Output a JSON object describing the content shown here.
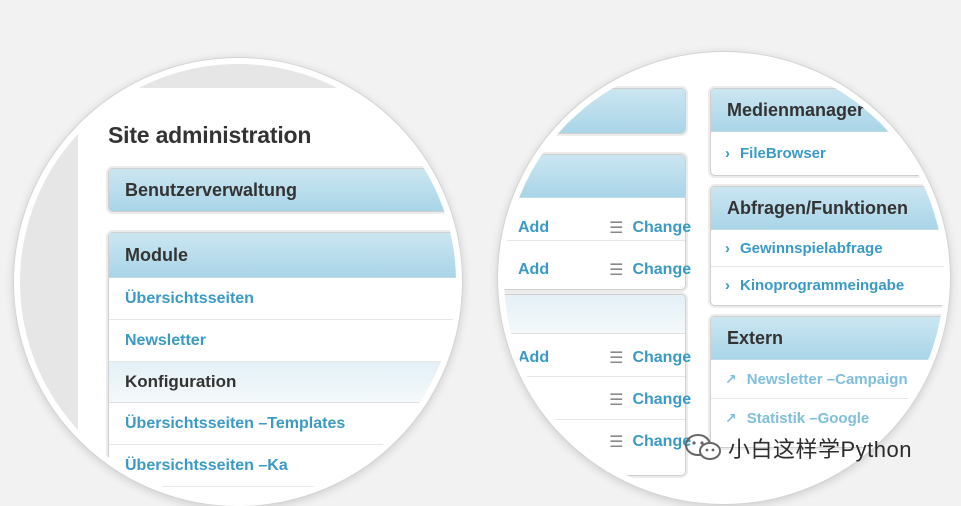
{
  "left": {
    "title": "Site administration",
    "benutzer": "Benutzerverwaltung",
    "module": {
      "header": "Module",
      "rows": [
        "Übersichtsseiten",
        "Newsletter"
      ],
      "subheader": "Konfiguration",
      "subrows": [
        "Übersichtsseiten –Templates",
        "Übersichtsseiten –Ka"
      ]
    }
  },
  "right": {
    "actions": {
      "add": "Add",
      "change": "Change"
    },
    "medien": {
      "header": "Medienmanager",
      "rows": [
        "FileBrowser"
      ]
    },
    "abfragen": {
      "header": "Abfragen/Funktionen",
      "rows": [
        "Gewinnspielabfrage",
        "Kinoprogrammeingabe"
      ]
    },
    "extern": {
      "header": "Extern",
      "rows": [
        "Newsletter –Campaign",
        "Statistik –Google"
      ]
    }
  },
  "watermark": "小白这样学Python"
}
